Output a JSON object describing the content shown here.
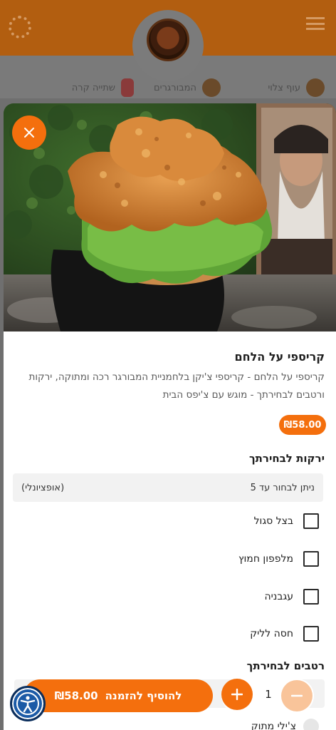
{
  "background": {
    "categories": [
      "עוף צלוי",
      "המבורגרים",
      "שתייה קרה"
    ]
  },
  "dish": {
    "title": "קריספי על הלחם",
    "description": "קריספי על הלחם - קריספי צ'יקן בלחמניית המבורגר רכה ומתוקה, ירקות ורטבים לבחירתך - מוגש עם צ'יפס הבית",
    "price": "₪58.00"
  },
  "vegetables": {
    "title": "ירקות לבחירתך",
    "limit_text": "ניתן לבחור עד 5",
    "optional_text": "(אופציונלי)",
    "options": [
      "בצל סגול",
      "מלפפון חמוץ",
      "עגבניה",
      "חסה לליק"
    ]
  },
  "sauces": {
    "title": "רטבים לבחירתך",
    "first_option": "צ'ילי מתוק"
  },
  "order": {
    "add_label": "להוסיף להזמנה",
    "total": "₪58.00",
    "quantity": "1"
  },
  "icons": {
    "close": "close-icon",
    "plus": "plus-icon",
    "minus": "minus-icon",
    "accessibility": "accessibility-icon"
  },
  "colors": {
    "accent": "#f46f0d",
    "accent_light": "#f9c49a",
    "accessibility": "#1b5aa6"
  }
}
